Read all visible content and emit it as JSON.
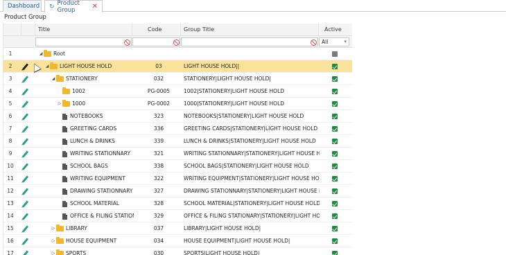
{
  "tabs": [
    {
      "label": "Dashboard"
    },
    {
      "label": "Product Group"
    }
  ],
  "page_title": "Product Group",
  "columns": {
    "title": "Title",
    "code": "Code",
    "group_title": "Group Title",
    "active": "Active"
  },
  "filter": {
    "active_value": "All"
  },
  "rows": [
    {
      "num": "1",
      "title": "Root",
      "code": "",
      "group": "",
      "indent": 0,
      "expander": "open",
      "kind": "folder",
      "active": "partial",
      "edit": false
    },
    {
      "num": "2",
      "title": "LIGHT HOUSE HOLD",
      "code": "03",
      "group": "LIGHT HOUSE HOLD||",
      "indent": 1,
      "expander": "open",
      "kind": "folder",
      "active": "yes",
      "edit": true,
      "selected": true
    },
    {
      "num": "3",
      "title": "STATIONERY",
      "code": "032",
      "group": "STATIONERY|LIGHT HOUSE HOLD|",
      "indent": 2,
      "expander": "open",
      "kind": "folder",
      "active": "yes",
      "edit": true
    },
    {
      "num": "4",
      "title": "1002",
      "code": "PG-0005",
      "group": "1002|STATIONERY|LIGHT HOUSE HOLD",
      "indent": 3,
      "expander": "none",
      "kind": "folder",
      "active": "yes",
      "edit": true
    },
    {
      "num": "5",
      "title": "1000",
      "code": "PG-0002",
      "group": "1000|STATIONERY|LIGHT HOUSE HOLD",
      "indent": 3,
      "expander": "closed",
      "kind": "folder",
      "active": "yes",
      "edit": true
    },
    {
      "num": "6",
      "title": "NOTEBOOKS",
      "code": "323",
      "group": "NOTEBOOKS|STATIONERY|LIGHT HOUSE HOLD",
      "indent": 3,
      "expander": "none",
      "kind": "file",
      "active": "yes",
      "edit": true
    },
    {
      "num": "7",
      "title": "GREETING CARDS",
      "code": "336",
      "group": "GREETING CARDS|STATIONERY|LIGHT HOUSE HOLD",
      "indent": 3,
      "expander": "none",
      "kind": "file",
      "active": "yes",
      "edit": true
    },
    {
      "num": "8",
      "title": "LUNCH & DRINKS",
      "code": "339",
      "group": "LUNCH & DRINKS|STATIONERY|LIGHT HOUSE HOLD",
      "indent": 3,
      "expander": "none",
      "kind": "file",
      "active": "yes",
      "edit": true
    },
    {
      "num": "9",
      "title": "WRITING STATIONNARY",
      "code": "321",
      "group": "WRITING STATIONNARY|STATIONERY|LIGHT HOUSE HOLD",
      "indent": 3,
      "expander": "none",
      "kind": "file",
      "active": "yes",
      "edit": true
    },
    {
      "num": "10",
      "title": "SCHOOL BAGS",
      "code": "338",
      "group": "SCHOOL BAGS|STATIONERY|LIGHT HOUSE HOLD",
      "indent": 3,
      "expander": "none",
      "kind": "file",
      "active": "yes",
      "edit": true
    },
    {
      "num": "11",
      "title": "WRITING EQUIPMENT",
      "code": "322",
      "group": "WRITING EQUIPMENT|STATIONERY|LIGHT HOUSE HOLD",
      "indent": 3,
      "expander": "none",
      "kind": "file",
      "active": "yes",
      "edit": true
    },
    {
      "num": "12",
      "title": "DRAWING STATIONNARY",
      "code": "327",
      "group": "DRAWING STATIONNARY|STATIONERY|LIGHT HOUSE HOLD",
      "indent": 3,
      "expander": "none",
      "kind": "file",
      "active": "yes",
      "edit": true
    },
    {
      "num": "13",
      "title": "SCHOOL MATERIAL",
      "code": "328",
      "group": "SCHOOL MATERIAL|STATIONERY|LIGHT HOUSE HOLD",
      "indent": 3,
      "expander": "none",
      "kind": "file",
      "active": "yes",
      "edit": true
    },
    {
      "num": "14",
      "title": "OFFICE & FILING STATIONARY",
      "code": "329",
      "group": "OFFICE & FILING STATIONARY|STATIONERY|LIGHT HOUSE HOLD",
      "indent": 3,
      "expander": "none",
      "kind": "file",
      "active": "yes",
      "edit": true
    },
    {
      "num": "15",
      "title": "LIBRARY",
      "code": "037",
      "group": "LIBRARY|LIGHT HOUSE HOLD|",
      "indent": 2,
      "expander": "closed",
      "kind": "folder",
      "active": "yes",
      "edit": true
    },
    {
      "num": "16",
      "title": "HOUSE EQUIPMENT",
      "code": "034",
      "group": "HOUSE EQUIPMENT|LIGHT HOUSE HOLD|",
      "indent": 2,
      "expander": "closed",
      "kind": "folder",
      "active": "yes",
      "edit": true
    },
    {
      "num": "17",
      "title": "SPORTS",
      "code": "030",
      "group": "SPORTS|LIGHT HOUSE HOLD|",
      "indent": 2,
      "expander": "closed",
      "kind": "folder",
      "active": "yes",
      "edit": true
    }
  ]
}
